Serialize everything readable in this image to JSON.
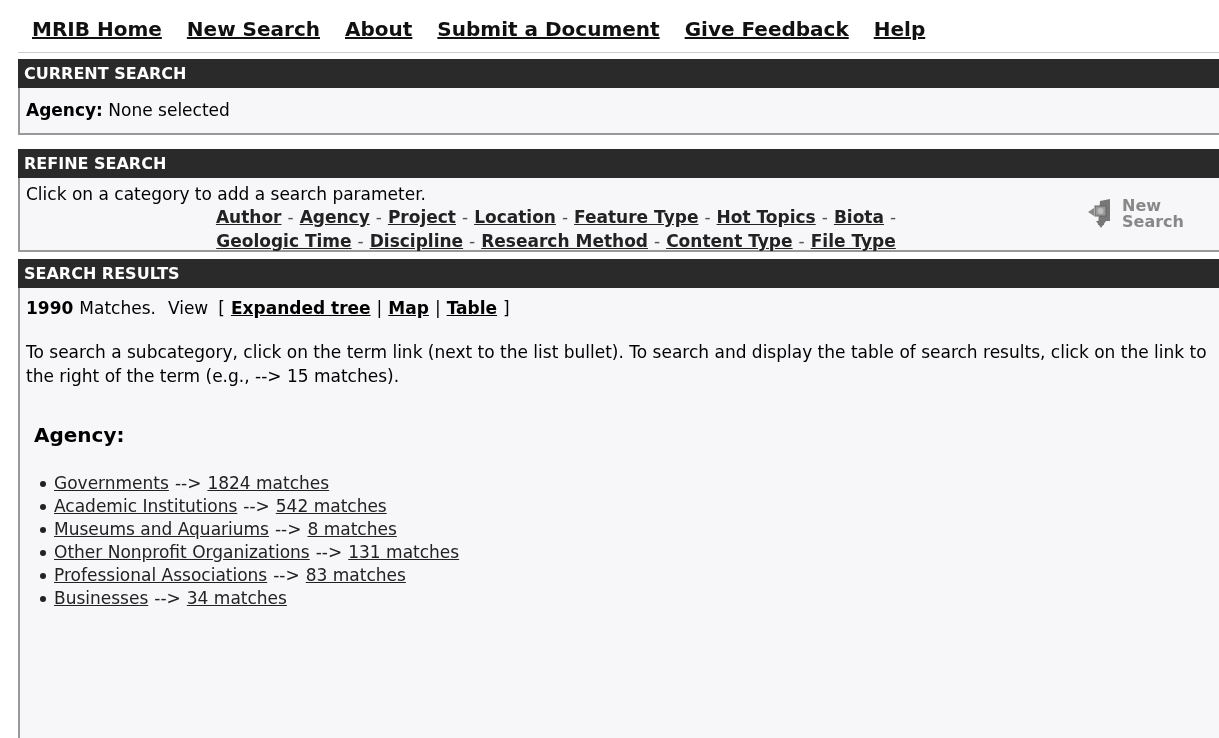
{
  "nav": [
    {
      "label": "MRIB Home"
    },
    {
      "label": "New Search"
    },
    {
      "label": "About"
    },
    {
      "label": "Submit a Document"
    },
    {
      "label": "Give Feedback"
    },
    {
      "label": "Help"
    }
  ],
  "current_search": {
    "title": "CURRENT SEARCH",
    "field_label": "Agency:",
    "field_value": "None selected"
  },
  "refine_search": {
    "title": "REFINE SEARCH",
    "instruction": "Click on a category to add a search parameter.",
    "category_rows": [
      [
        {
          "label": "Author",
          "after": "-"
        },
        {
          "label": "Agency",
          "after": "-"
        },
        {
          "label": "Project",
          "after": "-"
        },
        {
          "label": "Location",
          "after": "-"
        },
        {
          "label": "Feature Type",
          "after": "-"
        },
        {
          "label": "Hot Topics",
          "after": "-"
        },
        {
          "label": "Biota",
          "after": "-"
        }
      ],
      [
        {
          "label": "Geologic Time",
          "after": "-"
        },
        {
          "label": "Discipline",
          "after": "-"
        },
        {
          "label": "Research Method",
          "after": "-"
        },
        {
          "label": "Content Type",
          "after": "-"
        },
        {
          "label": "File Type"
        }
      ]
    ],
    "new_search_button": "New Search"
  },
  "search_results": {
    "title": "SEARCH RESULTS",
    "count": "1990",
    "count_label": "Matches.",
    "view_label": "View",
    "open_bracket": "[",
    "views": [
      {
        "label": "Expanded tree",
        "after": "|"
      },
      {
        "label": "Map",
        "after": "|"
      },
      {
        "label": "Table"
      }
    ],
    "close_bracket": "]",
    "help_text": "To search a subcategory, click on the term link (next to the list bullet). To search and display the table of search results, click on the link to the right of the term (e.g., --> 15 matches).",
    "heading": "Agency:",
    "items": [
      {
        "term": "Governments",
        "arrow": "-->",
        "matches": "1824 matches"
      },
      {
        "term": "Academic Institutions",
        "arrow": "-->",
        "matches": "542 matches"
      },
      {
        "term": "Museums and Aquariums",
        "arrow": "-->",
        "matches": "8 matches"
      },
      {
        "term": "Other Nonprofit Organizations",
        "arrow": "-->",
        "matches": "131 matches"
      },
      {
        "term": "Professional Associations",
        "arrow": "-->",
        "matches": "83 matches"
      },
      {
        "term": "Businesses",
        "arrow": "-->",
        "matches": "34 matches"
      }
    ]
  }
}
